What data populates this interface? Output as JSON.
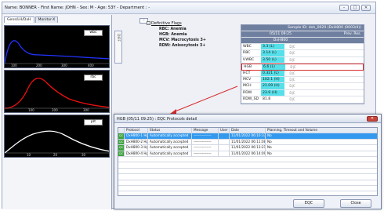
{
  "window": {
    "title": "Name: BONNER - First Name: JOHN - Sex: M - Age: 53Y - Department : -",
    "buttons": [
      "–",
      "□",
      "✕"
    ]
  },
  "left_tabs": [
    "Gens/LH/DxH",
    "Monitor-X"
  ],
  "plots": [
    {
      "label": "wbc",
      "color": "#2233ff",
      "x_ticks": [
        "100",
        "200",
        "300",
        "400"
      ]
    },
    {
      "label": "rbc",
      "color": "#ee1111",
      "x_ticks": [
        "100",
        "200",
        "300"
      ]
    },
    {
      "label": "plt",
      "color": "#ffffff",
      "x_ticks": [
        "10",
        "20",
        "30"
      ]
    }
  ],
  "diff_label": "DIFF",
  "collapse_label": "–",
  "flags": {
    "toggle": "−",
    "heading": "Definitive Flags",
    "items": [
      "RBC: Anemia",
      "HGB: Anemia",
      "MCV: Macrocytosis 3+",
      "RDW: Anisocytosis 3+"
    ]
  },
  "results": {
    "header": {
      "sample": "Sample ID:  dxh_0020 (DxH800 (0003/4))",
      "date": "05/11 09:25",
      "prev": "Prev. Res.",
      "instrument": "DxH800"
    },
    "rows": [
      {
        "param": "WBC",
        "value": "3.3 (L)",
        "flag": "D|C",
        "cyan": true,
        "highlight": false
      },
      {
        "param": "RBC",
        "value": "3.14 (L)",
        "flag": "D|C",
        "cyan": true,
        "highlight": false
      },
      {
        "param": "UWBC",
        "value": "3.50 (L)",
        "flag": "D|C",
        "cyan": true,
        "highlight": false
      },
      {
        "param": "HGB",
        "value": "6.6 (L)",
        "flag": "D|C",
        "cyan": true,
        "highlight": true
      },
      {
        "param": "HCT",
        "value": "0.321 (L)",
        "flag": "D|C",
        "cyan": true,
        "highlight": false
      },
      {
        "param": "MCV",
        "value": "102.1 (H)",
        "flag": "D|C",
        "cyan": true,
        "highlight": false
      },
      {
        "param": "MCH",
        "value": "21.09 (H)",
        "flag": "D|C",
        "cyan": true,
        "highlight": false
      },
      {
        "param": "RDW",
        "value": "23.9 (H)",
        "flag": "D|C",
        "cyan": true,
        "highlight": false
      },
      {
        "param": "RDW_SD",
        "value": "81.8",
        "flag": "D|C",
        "cyan": false,
        "highlight": false
      }
    ]
  },
  "dialog": {
    "title": "HGB (05/11 09:25) : EQC Protocols detail",
    "close": "✕",
    "columns": [
      "Protocol",
      "Status",
      "Message",
      "User",
      "Date",
      "Planning, Timeout and Volume"
    ],
    "rows": [
      {
        "qc": "QC",
        "protocol": "DxH800-1 Hgb",
        "status": "Automatically accepted",
        "message": "---------------",
        "user": "",
        "date": "11/01/2022 06:10:37",
        "planning": "No",
        "selected": true
      },
      {
        "qc": "QC",
        "protocol": "DxH800-2 Hgb",
        "status": "Automatically accepted",
        "message": "---------------",
        "user": "",
        "date": "11/01/2022 06:11:08",
        "planning": "No",
        "selected": false
      },
      {
        "qc": "QC",
        "protocol": "DxH800-3 Hgb",
        "status": "Automatically accepted",
        "message": "---------------",
        "user": "",
        "date": "11/01/2022 06:13:21",
        "planning": "No",
        "selected": false
      },
      {
        "qc": "QC",
        "protocol": "DxH800-4 Hgb",
        "status": "Automatically accepted",
        "message": "---------------",
        "user": "",
        "date": "11/01/2022 06:14:09",
        "planning": "No",
        "selected": false
      }
    ],
    "eqc_label": "EQC",
    "close_label": "Close"
  },
  "colors": {
    "cyan": "#56e0ea",
    "highlight": "#d62a2a",
    "selected": "#3399ee",
    "qc_green": "#3fa23f"
  }
}
